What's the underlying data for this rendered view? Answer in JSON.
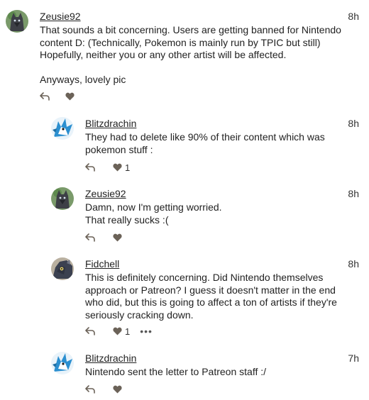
{
  "comments": [
    {
      "username": "Zeusie92",
      "time": "8h",
      "text": "That sounds a bit concerning. Users are getting banned for Nintendo\ncontent D: (Technically, Pokemon is mainly run by TPIC but still)\nHopefully, neither you or any other artist will be affected.\n\nAnyways, lovely pic",
      "likes": "",
      "avatar_icon": "wolf-avatar-icon"
    },
    {
      "username": "Blitzdrachin",
      "time": "8h",
      "text": "They had to delete like 90% of their content which was\npokemon stuff :",
      "likes": "1",
      "avatar_icon": "dragon-avatar-icon"
    },
    {
      "username": "Zeusie92",
      "time": "8h",
      "text": "Damn, now I'm getting worried.\nThat really sucks :(",
      "likes": "",
      "avatar_icon": "wolf-avatar-icon"
    },
    {
      "username": "Fidchell",
      "time": "8h",
      "text": "This is definitely concerning. Did Nintendo themselves\napproach or Patreon? I guess it doesn't matter in the end\nwho did, but this is going to affect a ton of artists if they're\nseriously cracking down.",
      "likes": "1",
      "more": "•••",
      "avatar_icon": "creature-avatar-icon"
    },
    {
      "username": "Blitzdrachin",
      "time": "7h",
      "text": "Nintendo sent the letter to Patreon staff :/",
      "likes": "",
      "avatar_icon": "dragon-avatar-icon"
    }
  ],
  "colors": {
    "icon": "#6b6258",
    "text": "#222222",
    "background": "#ffffff"
  }
}
